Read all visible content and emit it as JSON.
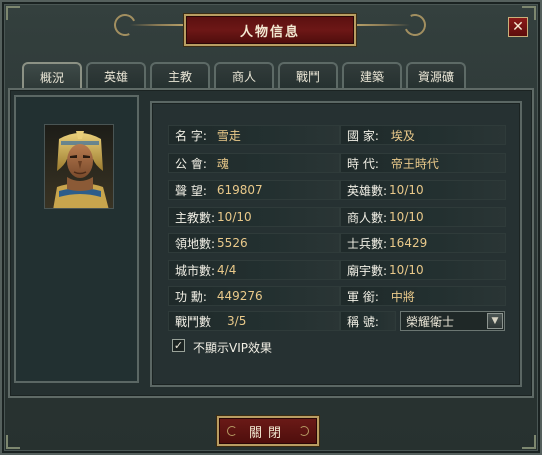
{
  "window": {
    "title": "人物信息"
  },
  "tabs": [
    {
      "label": "概況",
      "active": true
    },
    {
      "label": "英雄"
    },
    {
      "label": "主教"
    },
    {
      "label": "商人"
    },
    {
      "label": "戰鬥"
    },
    {
      "label": "建築"
    },
    {
      "label": "資源礦"
    }
  ],
  "info": {
    "name_label": "名 字:",
    "name_value": "雪走",
    "country_label": "國 家:",
    "country_value": "埃及",
    "guild_label": "公 會:",
    "guild_value": "魂",
    "era_label": "時 代:",
    "era_value": "帝王時代",
    "prestige_label": "聲 望:",
    "prestige_value": "619807",
    "heroes_label": "英雄數:",
    "heroes_value": "10/10",
    "bishops_label": "主教數:",
    "bishops_value": "10/10",
    "merchants_label": "商人數:",
    "merchants_value": "10/10",
    "territory_label": "領地數:",
    "territory_value": "5526",
    "soldiers_label": "士兵數:",
    "soldiers_value": "16429",
    "cities_label": "城市數:",
    "cities_value": "4/4",
    "temples_label": "廟宇數:",
    "temples_value": "10/10",
    "merit_label": "功 勳:",
    "merit_value": "449276",
    "rank_label": "軍 銜:",
    "rank_value": "中將",
    "battles_label": "戰鬥數",
    "battles_value": "3/5",
    "title_label": "稱 號:",
    "title_selected": "榮耀衛士"
  },
  "vip": {
    "label": "不顯示VIP效果",
    "checked": true
  },
  "footer": {
    "close_label": "關閉"
  },
  "icons": {
    "close": "close-icon",
    "dropdown": "chevron-down-icon",
    "check": "checkmark-icon"
  }
}
